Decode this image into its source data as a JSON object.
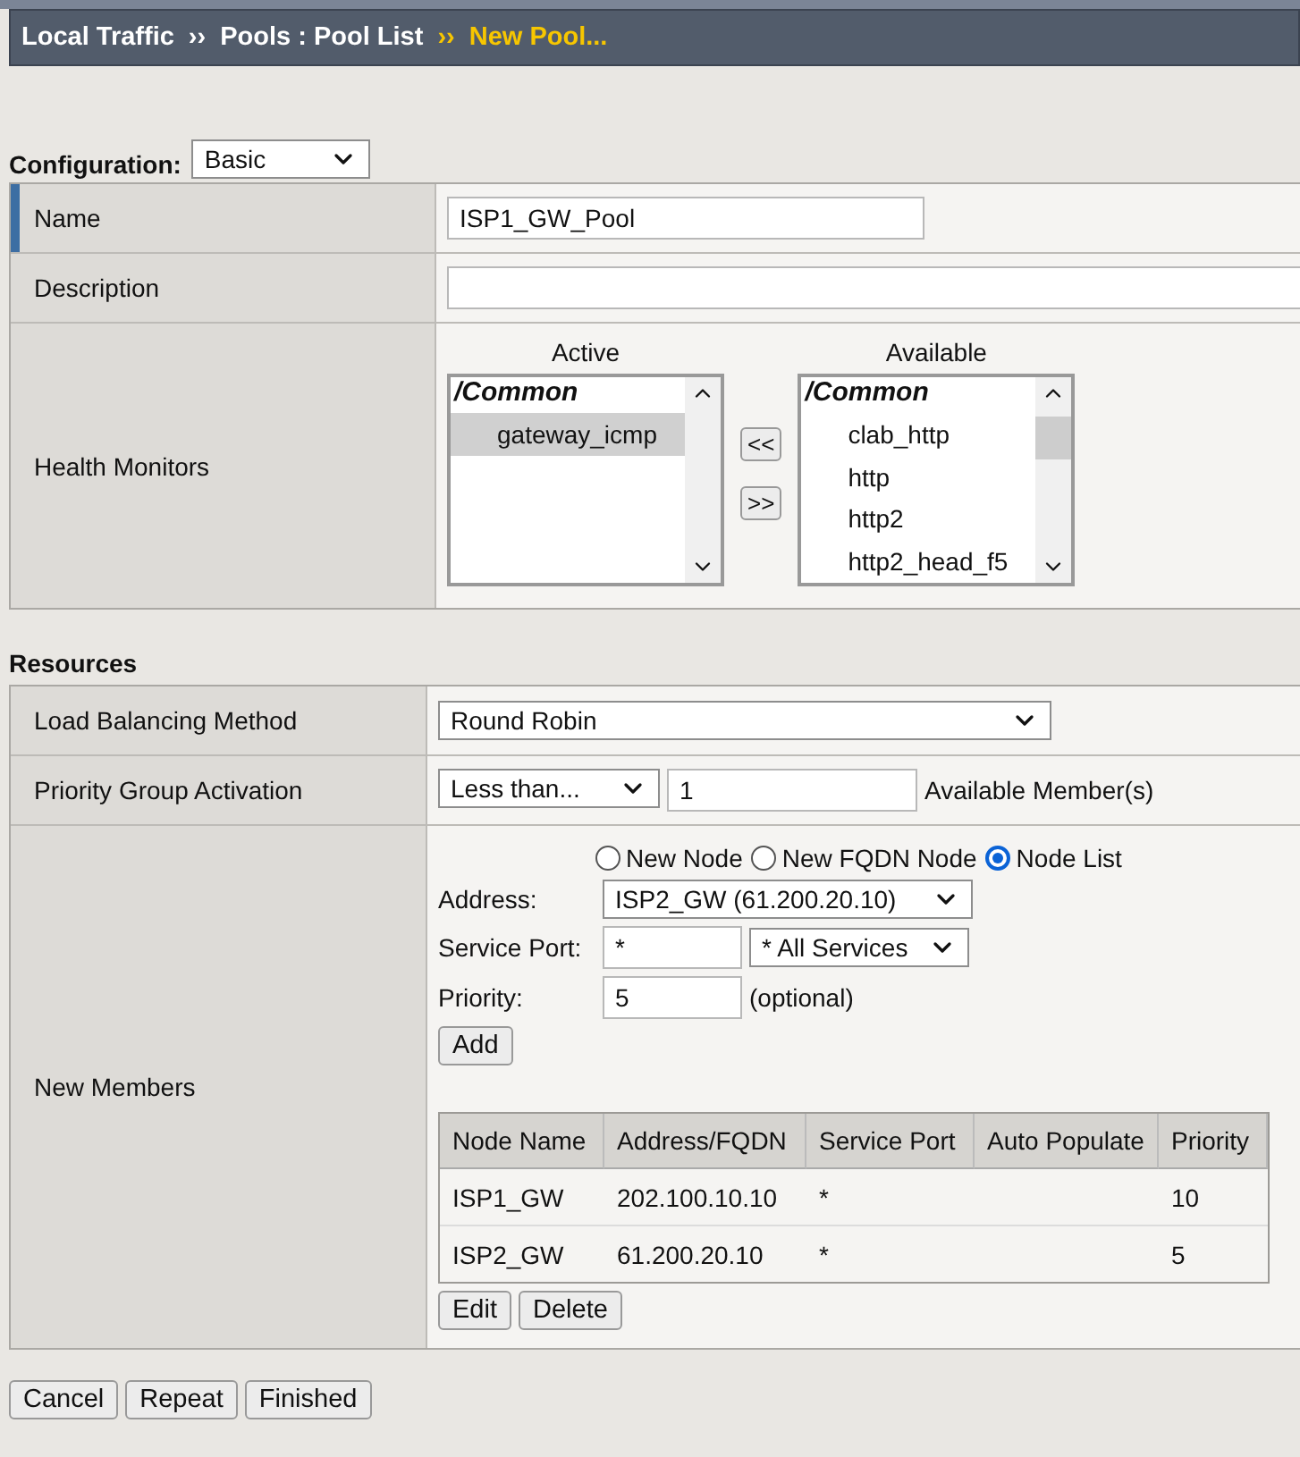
{
  "breadcrumb": {
    "separator": "››",
    "items": [
      {
        "text": "Local Traffic",
        "current": false
      },
      {
        "text": "Pools : Pool List",
        "current": false
      },
      {
        "text": "New Pool...",
        "current": true
      }
    ]
  },
  "configuration": {
    "label": "Configuration:",
    "value": "Basic"
  },
  "general": [
    {
      "kind": "input",
      "label": "Name",
      "value": "ISP1_GW_Pool",
      "required": true
    },
    {
      "kind": "wide-input",
      "label": "Description",
      "required": false
    },
    {
      "kind": "monitors",
      "label": "Health Monitors",
      "required": false,
      "move_left": "<<",
      "move_right": ">>",
      "active": {
        "heading": "Active",
        "folder": "/Common",
        "items": [
          {
            "text": "gateway_icmp",
            "selected": true
          }
        ]
      },
      "available": {
        "heading": "Available",
        "folder": "/Common",
        "items": [
          {
            "text": "clab_http",
            "selected": false
          },
          {
            "text": "http",
            "selected": false
          },
          {
            "text": "http2",
            "selected": false
          },
          {
            "text": "http2_head_f5",
            "selected": false
          }
        ]
      }
    }
  ],
  "resources": {
    "title": "Resources",
    "rows": [
      {
        "kind": "select",
        "label": "Load Balancing Method",
        "value": "Round Robin"
      },
      {
        "kind": "priority",
        "label": "Priority Group Activation",
        "value": "Less than...",
        "count": "1",
        "suffix": "Available Member(s)"
      },
      {
        "kind": "members",
        "label": "New Members"
      }
    ]
  },
  "members": {
    "radios": [
      {
        "label": "New Node",
        "selected": false
      },
      {
        "label": "New FQDN Node",
        "selected": false
      },
      {
        "label": "Node List",
        "selected": true
      }
    ],
    "address": {
      "label": "Address:",
      "value": "ISP2_GW (61.200.20.10)"
    },
    "service_port": {
      "label": "Service Port:",
      "value": "*",
      "service": "* All Services"
    },
    "priority": {
      "label": "Priority:",
      "value": "5",
      "hint": "(optional)"
    },
    "add_button": "Add",
    "table": {
      "columns": [
        "Node Name",
        "Address/FQDN",
        "Service Port",
        "Auto Populate",
        "Priority"
      ],
      "rows": [
        {
          "node_name": "ISP1_GW",
          "address": "202.100.10.10",
          "service_port": "*",
          "priority": "10"
        },
        {
          "node_name": "ISP2_GW",
          "address": "61.200.20.10",
          "service_port": "*",
          "priority": "5"
        }
      ]
    },
    "actions": [
      "Edit",
      "Delete"
    ]
  },
  "footer_buttons": [
    "Cancel",
    "Repeat",
    "Finished"
  ]
}
